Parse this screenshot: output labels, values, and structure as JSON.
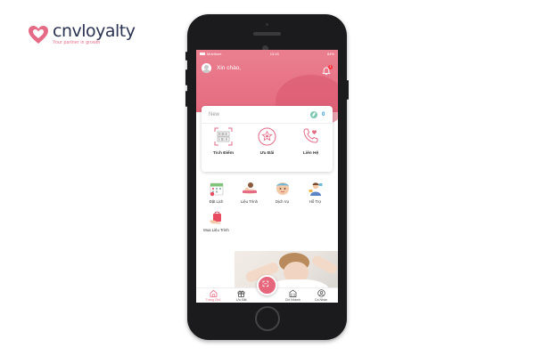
{
  "brand": {
    "name": "cnvloyalty",
    "tagline": "Your partner in growth",
    "accent_color": "#e46a86",
    "text_color": "#2b3352"
  },
  "status_bar": {
    "carrier": "Mobifone",
    "time": "13:15",
    "battery": "84%"
  },
  "header": {
    "greeting": "Xin chào,",
    "notification_count": "1",
    "background_color": "#e56b7f"
  },
  "member_card": {
    "tier": "New",
    "points": "0",
    "actions": [
      {
        "label": "Tích Điểm",
        "icon": "barcode-scan-icon"
      },
      {
        "label": "Ưu Đãi",
        "icon": "gift-icon"
      },
      {
        "label": "Liên Hệ",
        "icon": "phone-heart-icon"
      }
    ]
  },
  "menu": {
    "items": [
      {
        "label": "Đặt Lịch",
        "icon": "calendar-icon"
      },
      {
        "label": "Liệu Trình",
        "icon": "spa-treatment-icon"
      },
      {
        "label": "Dịch Vụ",
        "icon": "service-icon"
      },
      {
        "label": "Hỗ Trợ",
        "icon": "support-icon"
      },
      {
        "label": "Mua Liệu Trình",
        "icon": "shopping-bag-icon"
      }
    ]
  },
  "bottom_nav": {
    "items": [
      {
        "label": "Trang Chủ",
        "icon": "home-icon",
        "active": true
      },
      {
        "label": "Ưu Đãi",
        "icon": "gift-icon",
        "active": false
      },
      {
        "label": "Chi Nhánh",
        "icon": "branch-icon",
        "active": false
      },
      {
        "label": "Cá Nhân",
        "icon": "user-icon",
        "active": false
      }
    ],
    "center_button_icon": "qr-scan-icon"
  }
}
